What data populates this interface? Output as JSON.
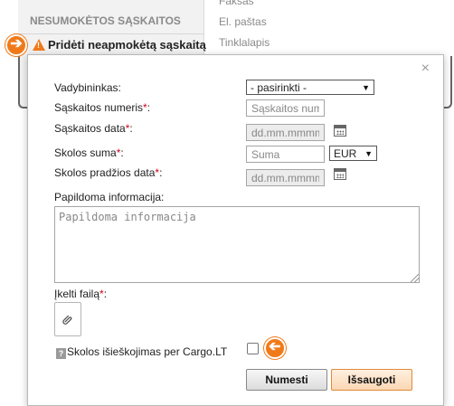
{
  "background": {
    "section_title": "NESUMOKĖTOS SĄSKAITOS",
    "add_invoice_link": "Pridėti neapmokėtą sąskaitą",
    "right_items": [
      "Faksas",
      "El. paštas",
      "Tinklalapis"
    ]
  },
  "dialog": {
    "close_symbol": "×",
    "manager": {
      "label": "Vadybininkas:",
      "selected": "- pasirinkti -"
    },
    "invoice_number": {
      "label": "Sąskaitos numeris",
      "placeholder": "Sąskaitos numeris"
    },
    "invoice_date": {
      "label": "Sąskaitos data",
      "placeholder": "dd.mm.mmmm"
    },
    "debt_amount": {
      "label": "Skolos suma",
      "placeholder": "Suma",
      "currency": "EUR"
    },
    "debt_start_date": {
      "label": "Skolos pradžios data",
      "placeholder": "dd.mm.mmmm"
    },
    "additional_info": {
      "label": "Papildoma informacija:",
      "placeholder": "Papildoma informacija"
    },
    "upload": {
      "label": "Įkelti failą"
    },
    "collection": {
      "help_symbol": "?",
      "label": "Skolos išieškojimas per Cargo.LT"
    },
    "buttons": {
      "cancel": "Numesti",
      "save": "Išsaugoti"
    },
    "required_mark": "*",
    "colon": ":"
  },
  "colors": {
    "accent": "#f07a1a",
    "required": "#d0021b"
  }
}
